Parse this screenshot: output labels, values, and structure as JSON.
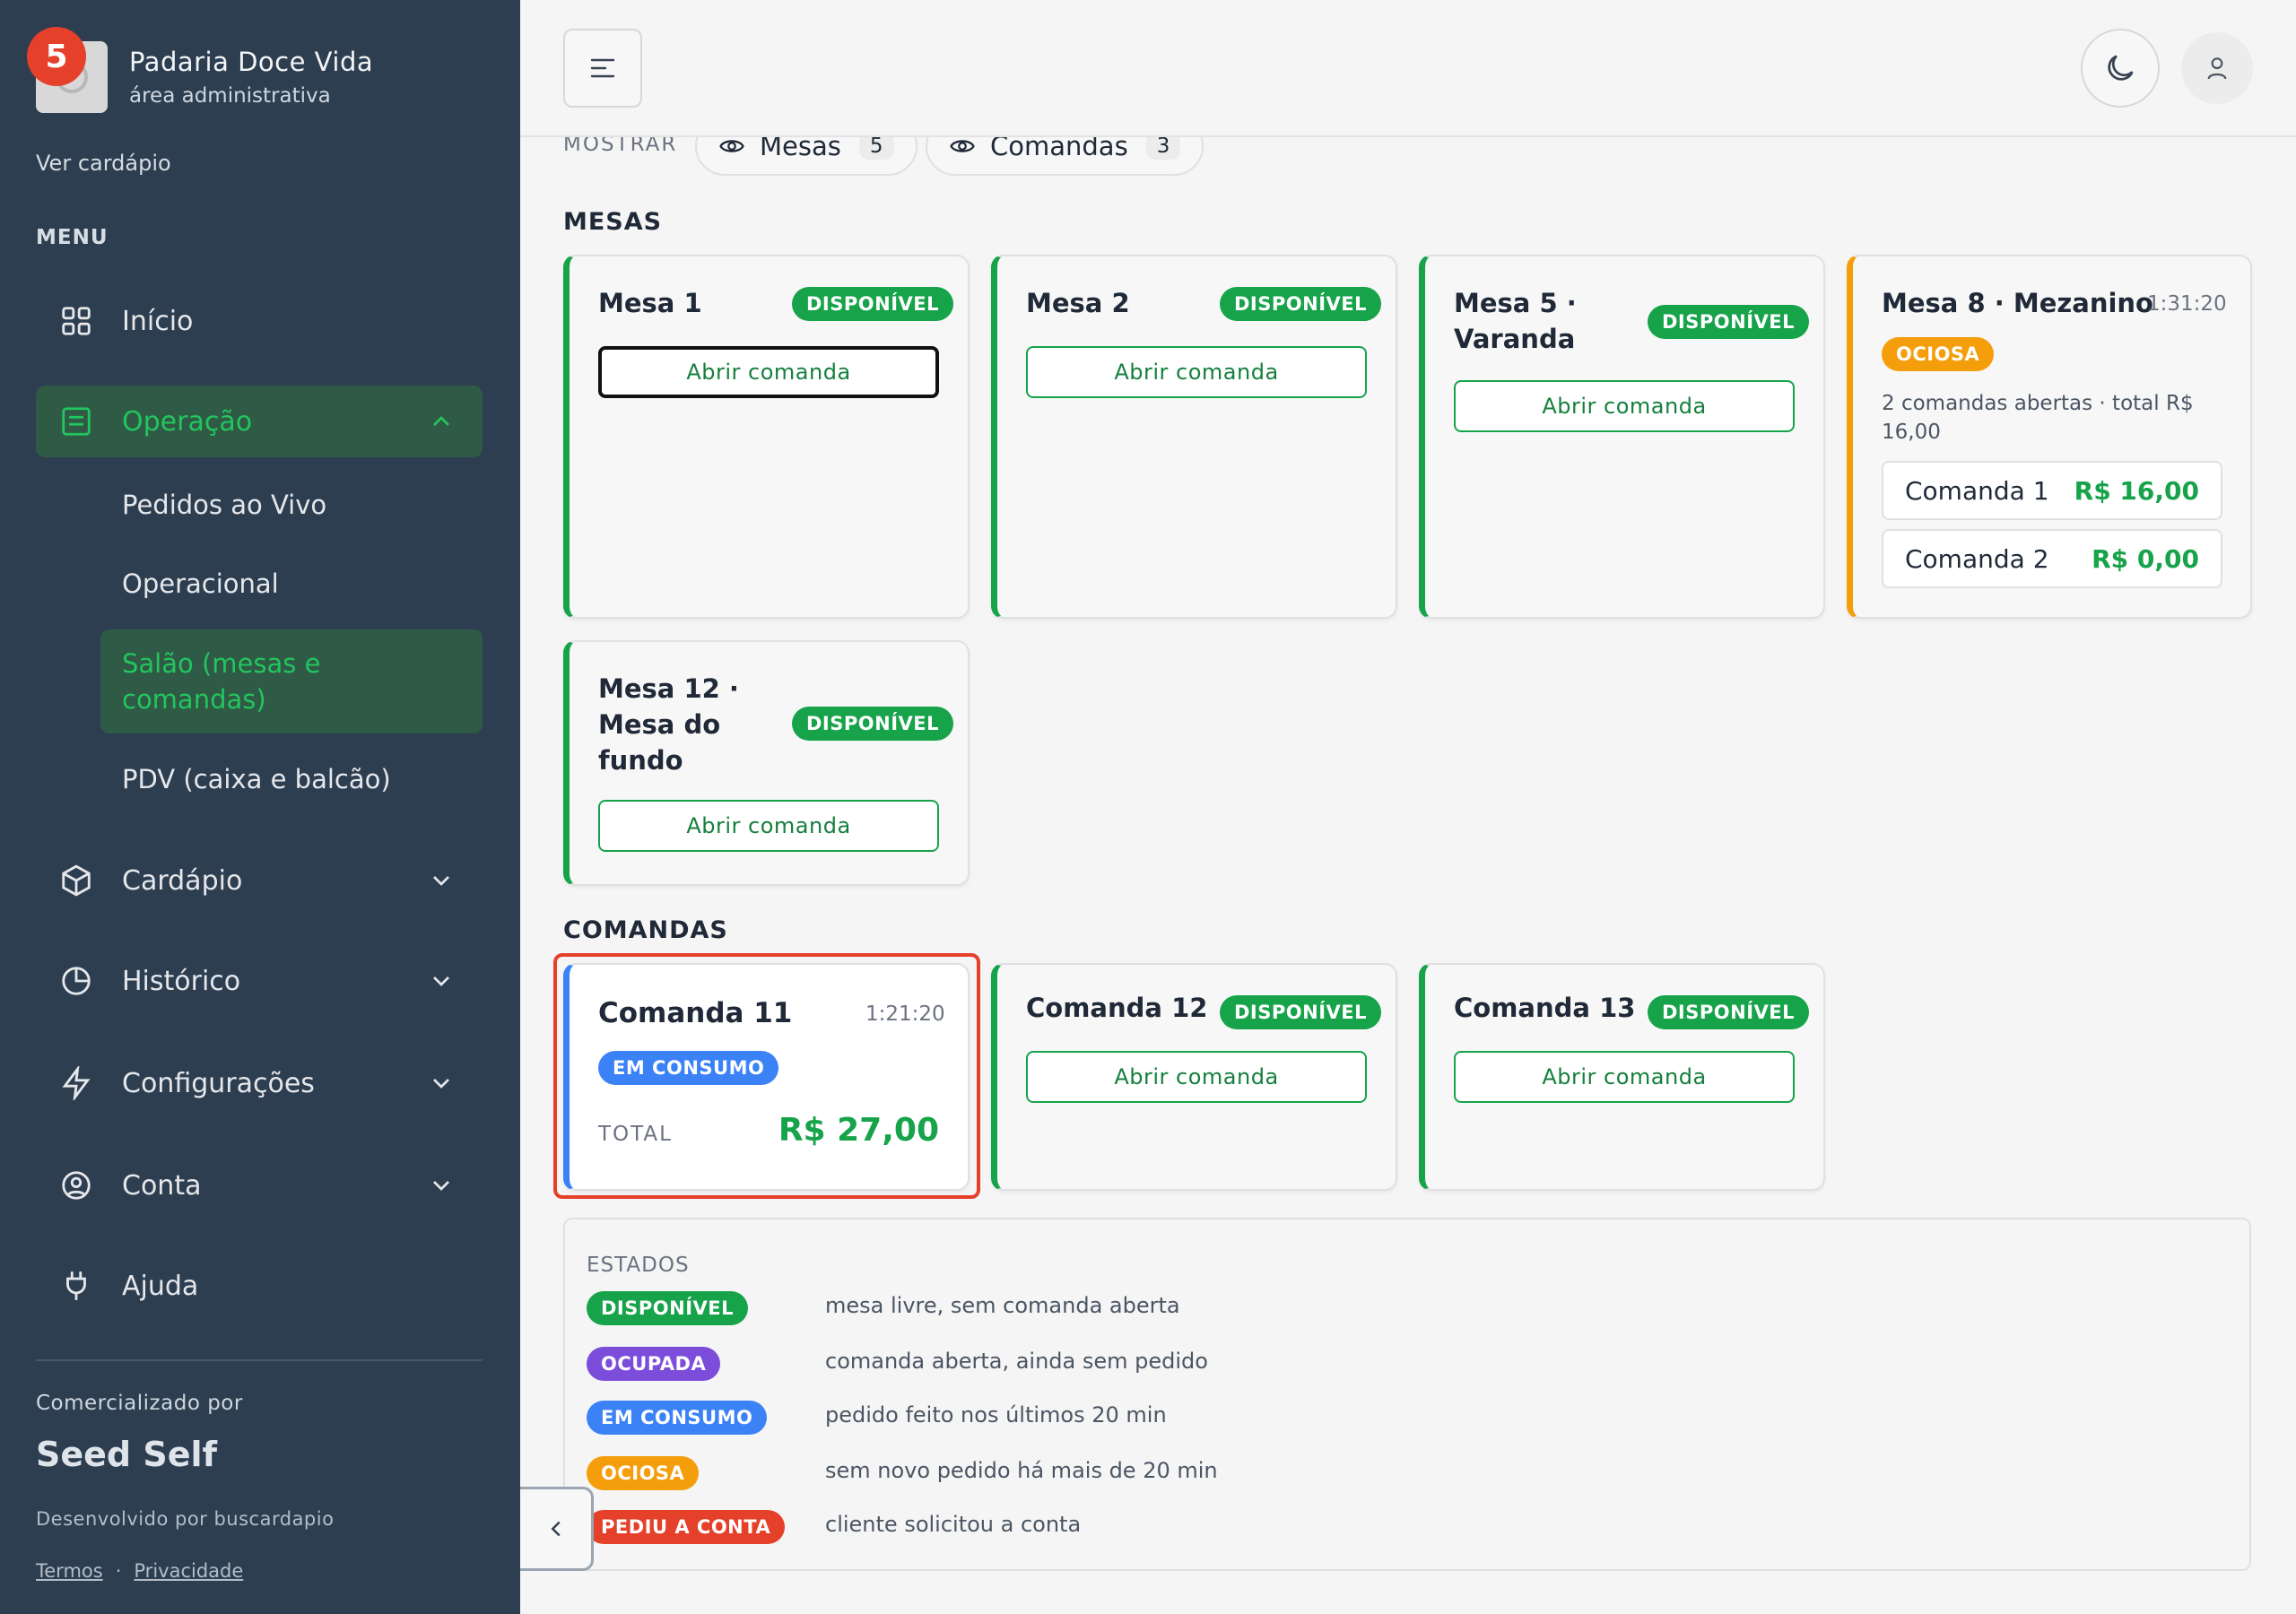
{
  "sidebar": {
    "notification_count": "5",
    "brand_name": "Padaria Doce Vida",
    "brand_sub": "área administrativa",
    "ver_cardapio": "Ver cardápio",
    "menu_label": "MENU",
    "items": {
      "inicio": "Início",
      "operacao": "Operação",
      "cardapio": "Cardápio",
      "historico": "Histórico",
      "configuracoes": "Configurações",
      "conta": "Conta",
      "ajuda": "Ajuda"
    },
    "sub_items": {
      "pedidos": "Pedidos ao Vivo",
      "operacional": "Operacional",
      "salao": "Salão (mesas e comandas)",
      "pdv": "PDV (caixa e balcão)"
    },
    "comercializado": "Comercializado por",
    "seed": "Seed Self",
    "desenvolvido": "Desenvolvido por buscardapio",
    "termos": "Termos",
    "dot": "·",
    "privacidade": "Privacidade"
  },
  "filters": {
    "mostrar": "MOSTRAR",
    "mesas_label": "Mesas",
    "mesas_count": "5",
    "comandas_label": "Comandas",
    "comandas_count": "3"
  },
  "sections": {
    "mesas": "MESAS",
    "comandas": "COMANDAS"
  },
  "common": {
    "disponivel": "DISPONÍVEL",
    "abrir": "Abrir comanda"
  },
  "mesas": {
    "m1": "Mesa 1",
    "m2": "Mesa 2",
    "m5": "Mesa 5 · Varanda",
    "m8": "Mesa 8 · Mezanino",
    "m8_time": "1:31:20",
    "m8_badge": "OCIOSA",
    "m8_summary": "2 comandas abertas · total R$ 16,00",
    "m8_c1": "Comanda 1",
    "m8_c1_amt": "R$ 16,00",
    "m8_c2": "Comanda 2",
    "m8_c2_amt": "R$ 0,00",
    "m12": "Mesa 12 · Mesa do fundo"
  },
  "comandas": {
    "c11": "Comanda 11",
    "c11_time": "1:21:20",
    "c11_badge": "EM CONSUMO",
    "c11_total_label": "TOTAL",
    "c11_total": "R$ 27,00",
    "c12": "Comanda 12",
    "c13": "Comanda 13"
  },
  "legend": {
    "title": "ESTADOS",
    "rows": [
      {
        "badge": "DISPONÍVEL",
        "desc": "mesa livre, sem comanda aberta"
      },
      {
        "badge": "OCUPADA",
        "desc": "comanda aberta, ainda sem pedido"
      },
      {
        "badge": "EM CONSUMO",
        "desc": "pedido feito nos últimos 20 min"
      },
      {
        "badge": "OCIOSA",
        "desc": "sem novo pedido há mais de 20 min"
      },
      {
        "badge": "PEDIU A CONTA",
        "desc": "cliente solicitou a conta"
      }
    ]
  },
  "colors": {
    "sidebar_bg": "#2d3e50",
    "accent_green": "#16a34a",
    "orange": "#f59e0b",
    "blue": "#3b82f6",
    "purple": "#7c4ddb",
    "red": "#e5402a"
  }
}
